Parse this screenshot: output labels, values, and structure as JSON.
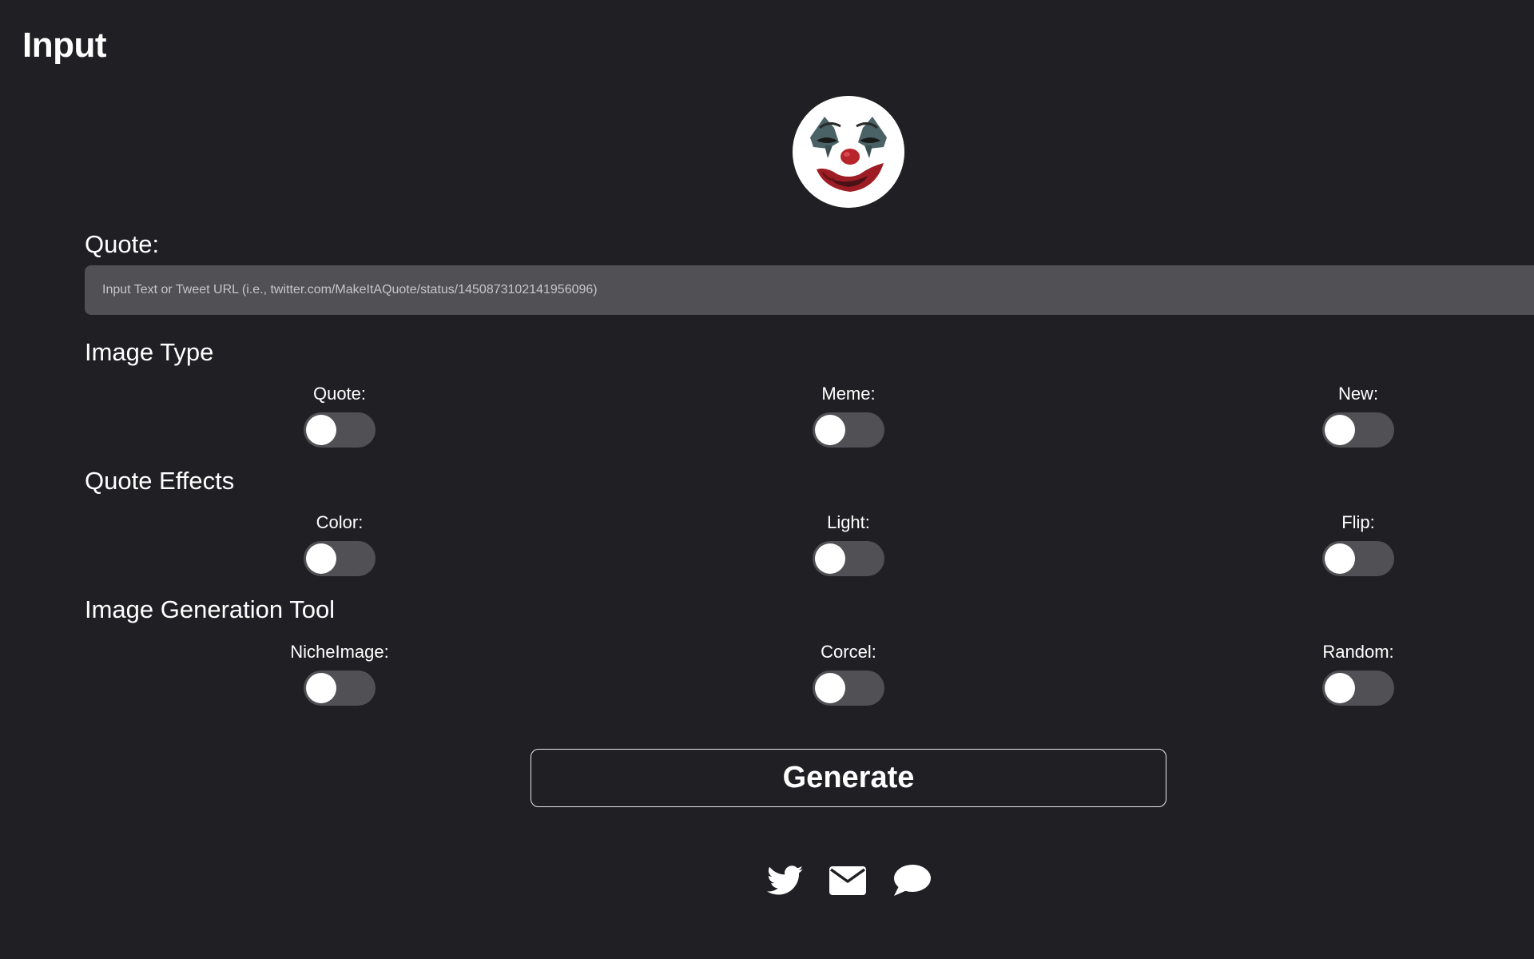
{
  "page": {
    "title": "Input"
  },
  "quote": {
    "label": "Quote:",
    "value": "",
    "placeholder": "Input Text or Tweet URL (i.e., twitter.com/MakeItAQuote/status/1450873102141956096)"
  },
  "image_type": {
    "heading": "Image Type",
    "options": [
      {
        "label": "Quote:",
        "on": false
      },
      {
        "label": "Meme:",
        "on": false
      },
      {
        "label": "New:",
        "on": false
      }
    ]
  },
  "quote_effects": {
    "heading": "Quote Effects",
    "options": [
      {
        "label": "Color:",
        "on": false
      },
      {
        "label": "Light:",
        "on": false
      },
      {
        "label": "Flip:",
        "on": false
      }
    ]
  },
  "generation_tool": {
    "heading": "Image Generation Tool",
    "options": [
      {
        "label": "NicheImage:",
        "on": false
      },
      {
        "label": "Corcel:",
        "on": false
      },
      {
        "label": "Random:",
        "on": false
      }
    ]
  },
  "actions": {
    "generate_label": "Generate"
  },
  "social_links": [
    "twitter-icon",
    "envelope-icon",
    "chat-bubble-icon"
  ],
  "colors": {
    "background": "#202024",
    "input_background": "#515155",
    "toggle_off": "#515155",
    "knob": "#ffffff",
    "text": "#ffffff"
  }
}
